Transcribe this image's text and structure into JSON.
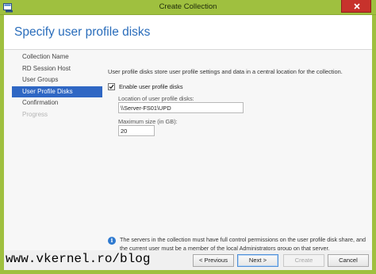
{
  "window": {
    "title": "Create Collection",
    "icon": "server-manager-icon",
    "close_icon": "close-icon",
    "frame_color": "#9fc03f"
  },
  "page": {
    "title": "Specify user profile disks"
  },
  "nav": {
    "items": [
      {
        "label": "Collection Name",
        "state": "normal"
      },
      {
        "label": "RD Session Host",
        "state": "normal"
      },
      {
        "label": "User Groups",
        "state": "normal"
      },
      {
        "label": "User Profile Disks",
        "state": "active"
      },
      {
        "label": "Confirmation",
        "state": "normal"
      },
      {
        "label": "Progress",
        "state": "disabled"
      }
    ],
    "active_color": "#2f67c4"
  },
  "content": {
    "description": "User profile disks store user profile settings and data in a central location for the collection.",
    "enable_checkbox": {
      "label": "Enable user profile disks",
      "checked": true
    },
    "location": {
      "label": "Location of user profile disks:",
      "value": "\\\\Server-FS01\\UPD"
    },
    "max_size": {
      "label": "Maximum size (in GB):",
      "value": "20"
    },
    "info": "The servers in the collection must have full control permissions on the user profile disk share, and the current user must be a member of the local Administrators group on that server."
  },
  "buttons": {
    "previous": "< Previous",
    "next": "Next >",
    "create": "Create",
    "cancel": "Cancel"
  },
  "watermark": "www.vkernel.ro/blog"
}
